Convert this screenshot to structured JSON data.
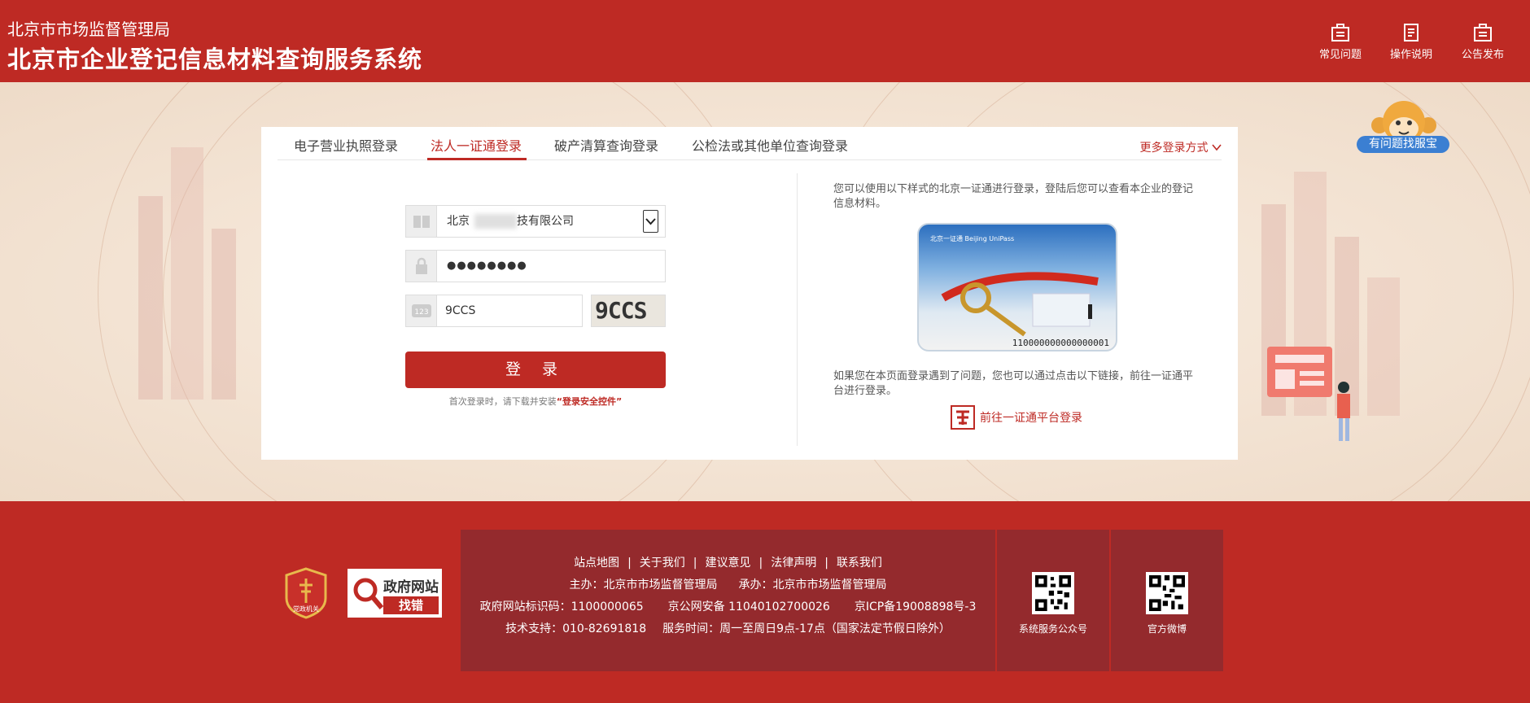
{
  "header": {
    "subtitle": "北京市市场监督管理局",
    "title": "北京市企业登记信息材料查询服务系统",
    "nav": [
      {
        "label": "常见问题",
        "icon": "faq-icon"
      },
      {
        "label": "操作说明",
        "icon": "document-icon"
      },
      {
        "label": "公告发布",
        "icon": "announcement-icon"
      }
    ]
  },
  "mascot": {
    "label": "有问题找服宝"
  },
  "tabs": {
    "items": [
      "电子营业执照登录",
      "法人一证通登录",
      "破产清算查询登录",
      "公检法或其他单位查询登录"
    ],
    "active_index": 1,
    "more": "更多登录方式"
  },
  "form": {
    "company_value": "北京",
    "company_suffix": "技有限公司",
    "password_value": "●●●●●●●●",
    "captcha_value": "9CCS",
    "captcha_image_text": "9CCS",
    "login_label": "登 录",
    "hint_prefix": "首次登录时，请下载并安装",
    "hint_link": "“登录安全控件”"
  },
  "right": {
    "intro": "您可以使用以下样式的北京一证通进行登录，登陆后您可以查看本企业的登记信息材料。",
    "card_number": "110000000000000001",
    "card_logo": "北京一证通 Beijing UniPass",
    "help": "如果您在本页面登录遇到了问题，您也可以通过点击以下链接，前往一证通平台进行登录。",
    "goto_link": "前往一证通平台登录"
  },
  "footer": {
    "links": [
      "站点地图",
      "关于我们",
      "建议意见",
      "法律声明",
      "联系我们"
    ],
    "sponsor": "主办：北京市市场监督管理局",
    "organizer": "承办：北京市市场监督管理局",
    "gov_id": "政府网站标识码：1100000065",
    "police_id": "京公网安备 11040102700026",
    "icp": "京ICP备19008898号-3",
    "support": "技术支持：010-82691818",
    "service_time": "服务时间：周一至周日9点-17点（国家法定节假日除外）",
    "badge_party": "党政机关",
    "badge_gov_title": "政府网站",
    "badge_gov_sub": "找错",
    "qr1_label": "系统服务公众号",
    "qr2_label": "官方微博"
  },
  "colors": {
    "brand_red": "#be2a24",
    "footer_panel": "#942a2d",
    "mascot_blue": "#3b7fd2"
  }
}
